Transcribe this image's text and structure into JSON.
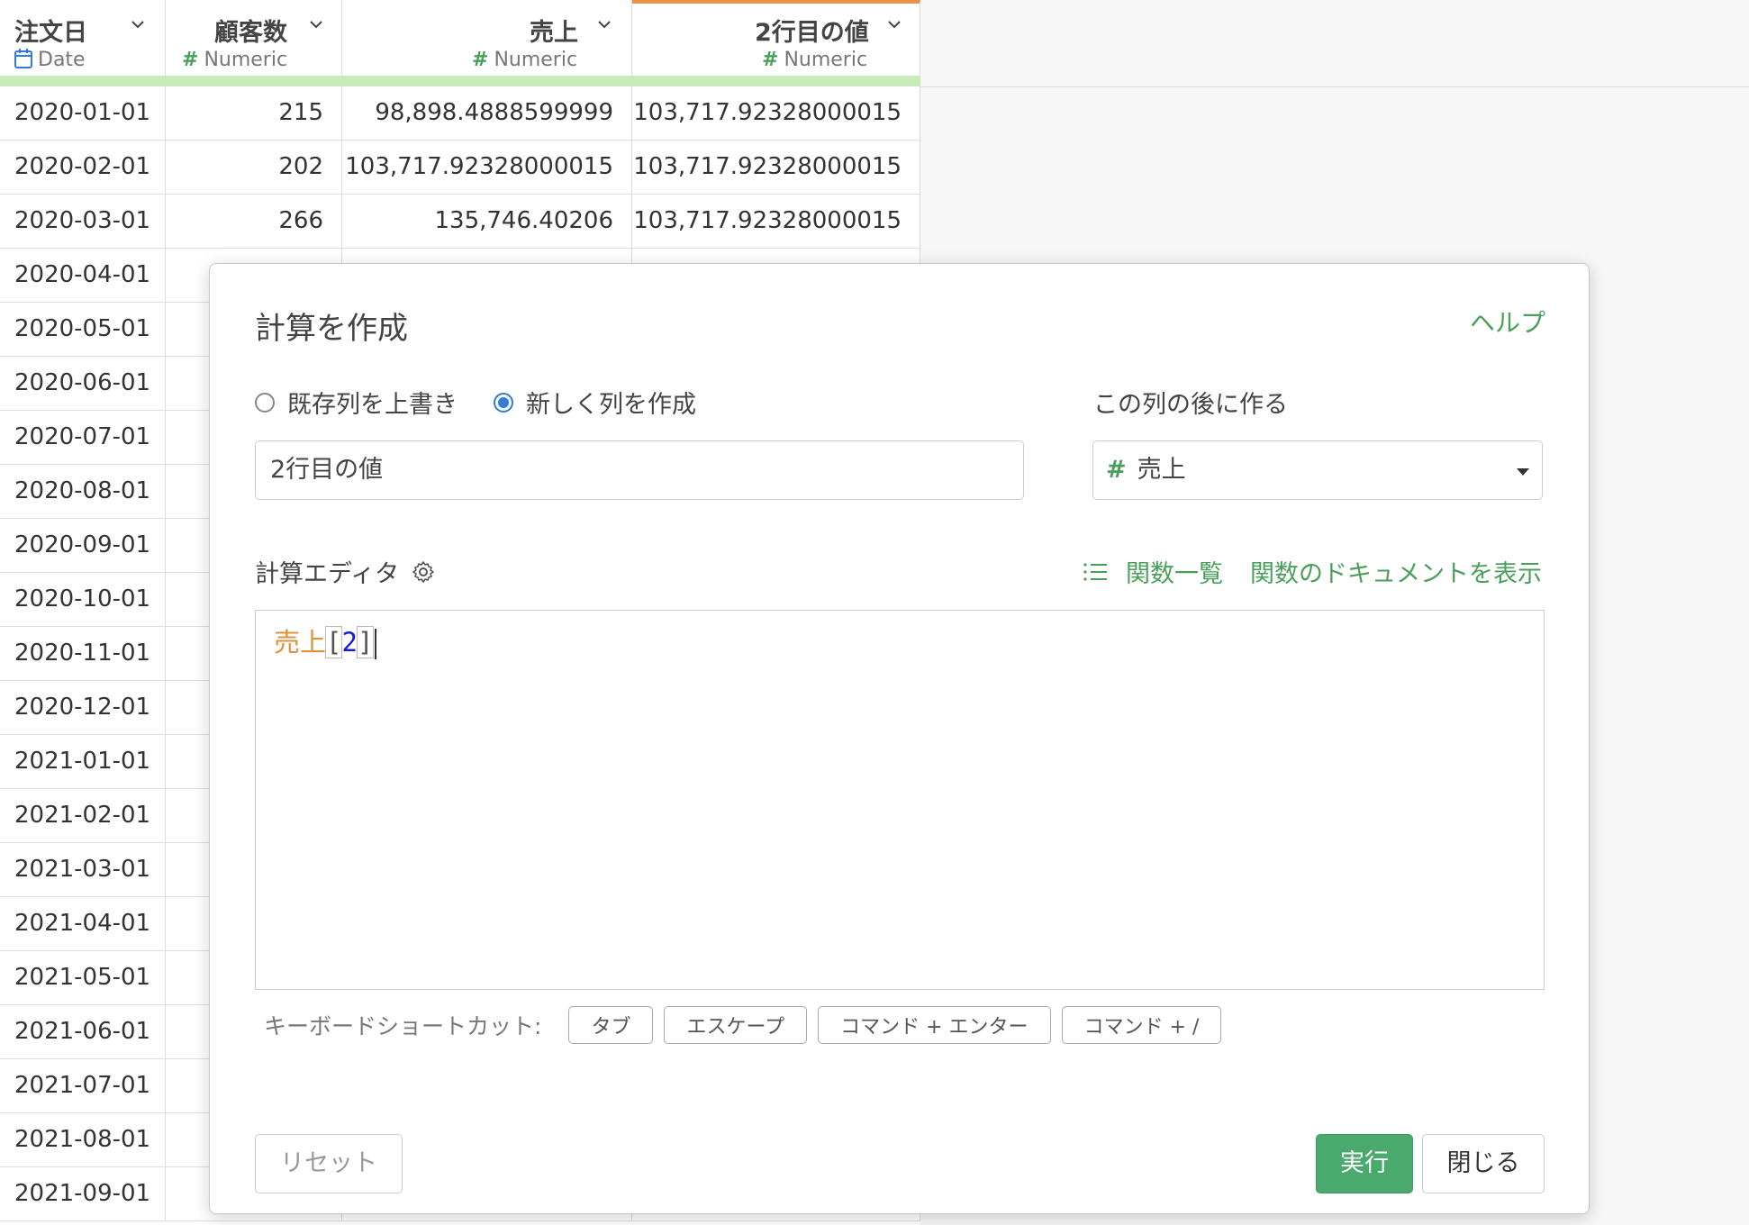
{
  "table": {
    "columns": [
      {
        "name": "注文日",
        "type": "Date"
      },
      {
        "name": "顧客数",
        "type": "Numeric"
      },
      {
        "name": "売上",
        "type": "Numeric"
      },
      {
        "name": "2行目の値",
        "type": "Numeric"
      }
    ],
    "rows": [
      [
        "2020-01-01",
        "215",
        "98,898.4888599999",
        "103,717.92328000015"
      ],
      [
        "2020-02-01",
        "202",
        "103,717.92328000015",
        "103,717.92328000015"
      ],
      [
        "2020-03-01",
        "266",
        "135,746.40206",
        "103,717.92328000015"
      ],
      [
        "2020-04-01",
        "",
        "",
        ""
      ],
      [
        "2020-05-01",
        "",
        "",
        ""
      ],
      [
        "2020-06-01",
        "",
        "",
        ""
      ],
      [
        "2020-07-01",
        "",
        "",
        ""
      ],
      [
        "2020-08-01",
        "",
        "",
        ""
      ],
      [
        "2020-09-01",
        "",
        "",
        ""
      ],
      [
        "2020-10-01",
        "",
        "",
        ""
      ],
      [
        "2020-11-01",
        "",
        "",
        ""
      ],
      [
        "2020-12-01",
        "",
        "",
        ""
      ],
      [
        "2021-01-01",
        "",
        "",
        ""
      ],
      [
        "2021-02-01",
        "",
        "",
        ""
      ],
      [
        "2021-03-01",
        "",
        "",
        ""
      ],
      [
        "2021-04-01",
        "",
        "",
        ""
      ],
      [
        "2021-05-01",
        "",
        "",
        ""
      ],
      [
        "2021-06-01",
        "",
        "",
        ""
      ],
      [
        "2021-07-01",
        "",
        "",
        ""
      ],
      [
        "2021-08-01",
        "",
        "",
        ""
      ],
      [
        "2021-09-01",
        "",
        "",
        ""
      ]
    ]
  },
  "dialog": {
    "title": "計算を作成",
    "help": "ヘルプ",
    "radio_overwrite": "既存列を上書き",
    "radio_new": "新しく列を作成",
    "after_label": "この列の後に作る",
    "column_name_value": "2行目の値",
    "after_column_value": "売上",
    "editor_label": "計算エディタ",
    "function_list": "関数一覧",
    "function_docs": "関数のドキュメントを表示",
    "code": {
      "ident": "売上",
      "open": "[",
      "num": "2",
      "close": "]"
    },
    "shortcuts_label": "キーボードショートカット:",
    "shortcuts": [
      "タブ",
      "エスケープ",
      "コマンド + エンター",
      "コマンド + /"
    ],
    "reset": "リセット",
    "run": "実行",
    "close": "閉じる"
  },
  "colors": {
    "accent_green": "#4aa05a",
    "run_button": "#4aa96c",
    "selected_column_border": "#e8924a",
    "quality_bar": "#c7ecb8",
    "radio_blue": "#2f7be0"
  }
}
